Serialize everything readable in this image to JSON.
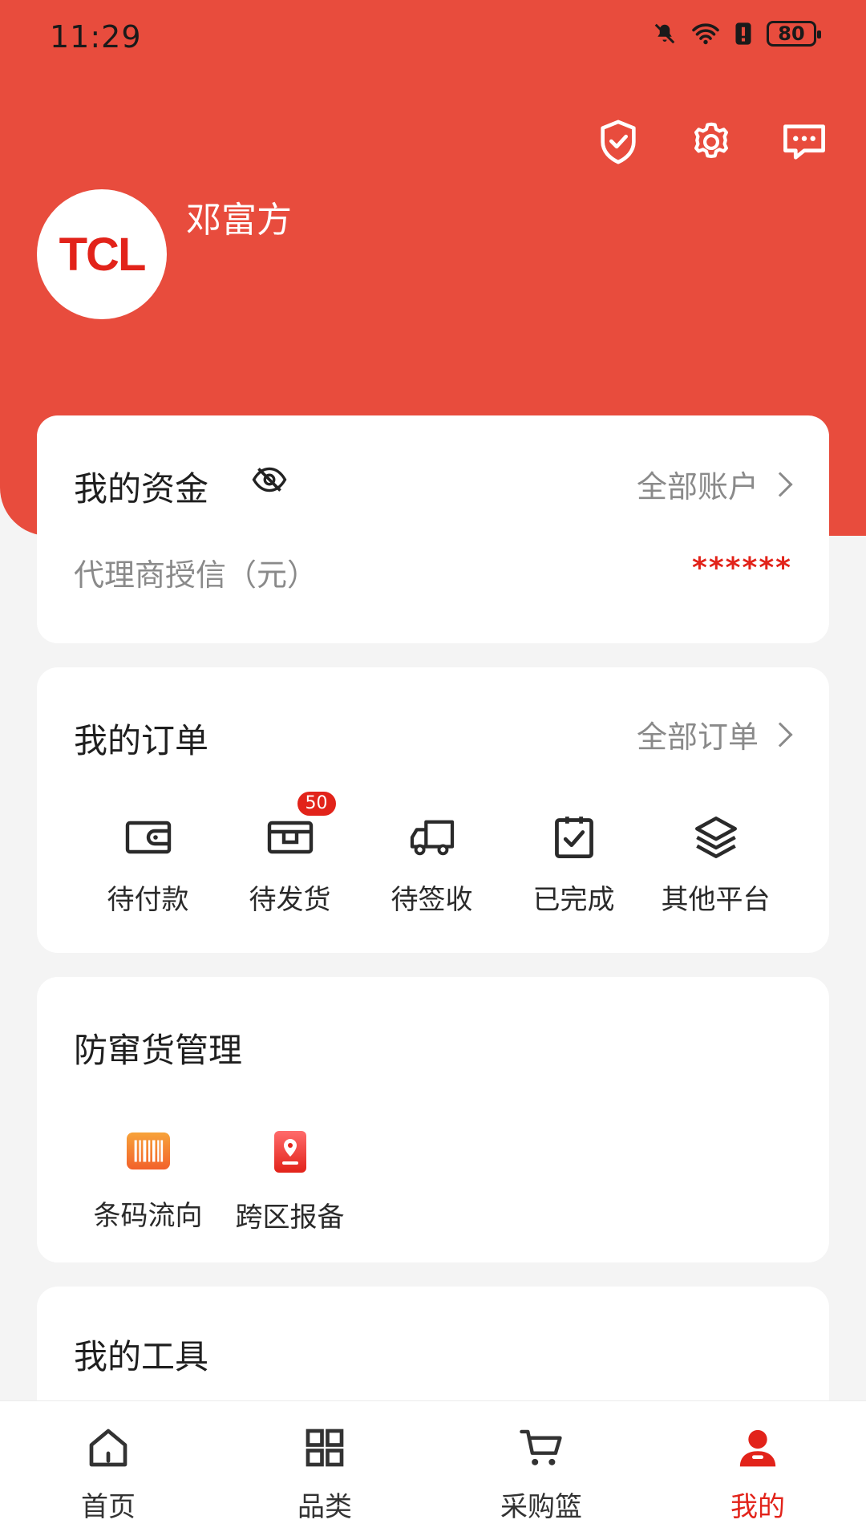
{
  "status_bar": {
    "time": "11:29",
    "battery": "80"
  },
  "header": {
    "avatar_text": "TCL",
    "user_name": "邓富方",
    "icons": [
      "shield-check-icon",
      "gear-icon",
      "message-icon"
    ]
  },
  "funds": {
    "title": "我的资金",
    "link": "全部账户",
    "credit_label": "代理商授信（元）",
    "credit_value": "******"
  },
  "orders": {
    "title": "我的订单",
    "link": "全部订单",
    "items": [
      {
        "label": "待付款",
        "icon": "wallet-icon"
      },
      {
        "label": "待发货",
        "icon": "box-icon",
        "badge": "50"
      },
      {
        "label": "待签收",
        "icon": "truck-icon"
      },
      {
        "label": "已完成",
        "icon": "clipboard-check-icon"
      },
      {
        "label": "其他平台",
        "icon": "layers-icon"
      }
    ]
  },
  "anti_channel": {
    "title": "防窜货管理",
    "items": [
      {
        "label": "条码流向",
        "icon": "barcode-icon"
      },
      {
        "label": "跨区报备",
        "icon": "location-book-icon"
      }
    ]
  },
  "tools": {
    "title": "我的工具"
  },
  "tabbar": {
    "items": [
      {
        "label": "首页",
        "icon": "home-icon"
      },
      {
        "label": "品类",
        "icon": "grid-icon"
      },
      {
        "label": "采购篮",
        "icon": "cart-icon"
      },
      {
        "label": "我的",
        "icon": "user-icon"
      }
    ],
    "active_index": 3
  },
  "colors": {
    "brand_red": "#e84c3d",
    "accent_red": "#e2231a",
    "page_bg": "#f4f4f4"
  }
}
